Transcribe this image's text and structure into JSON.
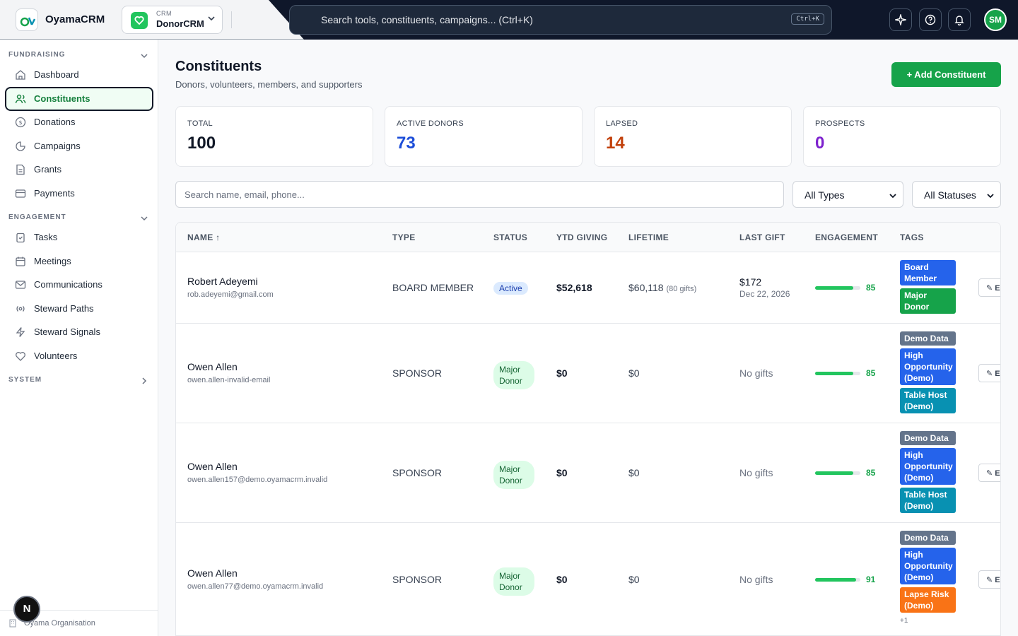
{
  "app": {
    "name": "OyamaCRM",
    "crm_small": "CRM",
    "crm_name": "DonorCRM"
  },
  "search": {
    "placeholder": "Search tools, constituents, campaigns... (Ctrl+K)",
    "shortcut": "Ctrl+K"
  },
  "user": {
    "initials": "SM"
  },
  "sidebar": {
    "sections": [
      {
        "title": "FUNDRAISING",
        "items": [
          {
            "label": "Dashboard",
            "icon": "home-icon"
          },
          {
            "label": "Constituents",
            "icon": "users-icon",
            "active": true
          },
          {
            "label": "Donations",
            "icon": "dollar-icon"
          },
          {
            "label": "Campaigns",
            "icon": "pie-icon"
          },
          {
            "label": "Grants",
            "icon": "file-icon"
          },
          {
            "label": "Payments",
            "icon": "card-icon"
          }
        ]
      },
      {
        "title": "ENGAGEMENT",
        "items": [
          {
            "label": "Tasks",
            "icon": "clipboard-icon"
          },
          {
            "label": "Meetings",
            "icon": "calendar-icon"
          },
          {
            "label": "Communications",
            "icon": "mail-icon"
          },
          {
            "label": "Steward Paths",
            "icon": "radio-icon"
          },
          {
            "label": "Steward Signals",
            "icon": "zap-icon"
          },
          {
            "label": "Volunteers",
            "icon": "heart-icon"
          }
        ]
      },
      {
        "title": "SYSTEM",
        "items": []
      }
    ],
    "org": "Oyama Organisation",
    "n_button": "N"
  },
  "page": {
    "title": "Constituents",
    "subtitle": "Donors, volunteers, members, and supporters",
    "add_button": "+  Add Constituent"
  },
  "stats": [
    {
      "label": "TOTAL",
      "value": "100",
      "color": "#111827"
    },
    {
      "label": "ACTIVE DONORS",
      "value": "73",
      "color": "#1d4ed8"
    },
    {
      "label": "LAPSED",
      "value": "14",
      "color": "#c2410c"
    },
    {
      "label": "PROSPECTS",
      "value": "0",
      "color": "#7e22ce"
    }
  ],
  "filters": {
    "search_placeholder": "Search name, email, phone...",
    "type": "All Types",
    "status": "All Statuses"
  },
  "table": {
    "headers": [
      "NAME ↑",
      "TYPE",
      "STATUS",
      "YTD GIVING",
      "LIFETIME",
      "LAST GIFT",
      "ENGAGEMENT",
      "TAGS"
    ],
    "rows": [
      {
        "name": "Robert Adeyemi",
        "email": "rob.adeyemi@gmail.com",
        "type": "BOARD MEMBER",
        "status": "Active",
        "ytd": "$52,618",
        "lifetime": "$60,118",
        "gifts": "(80 gifts)",
        "last_gift": "$172",
        "last_date": "Dec 22, 2026",
        "engagement": 85,
        "tags": [
          {
            "label": "Board Member",
            "color": "#2563eb"
          },
          {
            "label": "Major Donor",
            "color": "#16a34a"
          }
        ],
        "more": "",
        "edit": "E"
      },
      {
        "name": "Owen Allen",
        "email": "owen.allen-invalid-email",
        "type": "SPONSOR",
        "status": "Major Donor",
        "ytd": "$0",
        "lifetime": "$0",
        "gifts": "",
        "last_gift": "No gifts",
        "last_date": "",
        "engagement": 85,
        "tags": [
          {
            "label": "Demo Data",
            "color": "#64748b"
          },
          {
            "label": "High Opportunity (Demo)",
            "color": "#2563eb"
          },
          {
            "label": "Table Host (Demo)",
            "color": "#0891b2"
          }
        ],
        "more": "",
        "edit": "E"
      },
      {
        "name": "Owen Allen",
        "email": "owen.allen157@demo.oyamacrm.invalid",
        "type": "SPONSOR",
        "status": "Major Donor",
        "ytd": "$0",
        "lifetime": "$0",
        "gifts": "",
        "last_gift": "No gifts",
        "last_date": "",
        "engagement": 85,
        "tags": [
          {
            "label": "Demo Data",
            "color": "#64748b"
          },
          {
            "label": "High Opportunity (Demo)",
            "color": "#2563eb"
          },
          {
            "label": "Table Host (Demo)",
            "color": "#0891b2"
          }
        ],
        "more": "",
        "edit": "E"
      },
      {
        "name": "Owen Allen",
        "email": "owen.allen77@demo.oyamacrm.invalid",
        "type": "SPONSOR",
        "status": "Major Donor",
        "ytd": "$0",
        "lifetime": "$0",
        "gifts": "",
        "last_gift": "No gifts",
        "last_date": "",
        "engagement": 91,
        "tags": [
          {
            "label": "Demo Data",
            "color": "#64748b"
          },
          {
            "label": "High Opportunity (Demo)",
            "color": "#2563eb"
          },
          {
            "label": "Lapse Risk (Demo)",
            "color": "#f97316"
          }
        ],
        "more": "+1",
        "edit": "E"
      }
    ]
  }
}
